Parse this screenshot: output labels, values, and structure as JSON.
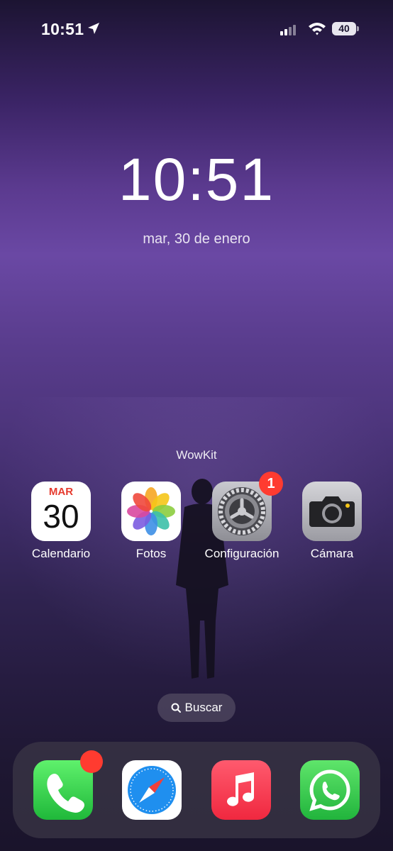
{
  "status_bar": {
    "time": "10:51",
    "battery": "40",
    "icons": [
      "location-arrow-icon",
      "signal-icon",
      "wifi-icon",
      "battery-icon"
    ]
  },
  "lock": {
    "time": "10:51",
    "date": "mar, 30 de enero"
  },
  "folder_label": "WowKit",
  "apps": [
    {
      "label": "Calendario",
      "icon": "calendar-icon",
      "day": "MAR",
      "number": "30"
    },
    {
      "label": "Fotos",
      "icon": "photos-icon"
    },
    {
      "label": "Configuración",
      "icon": "settings-gear-icon",
      "badge": "1"
    },
    {
      "label": "Cámara",
      "icon": "camera-icon"
    }
  ],
  "search": {
    "label": "Buscar"
  },
  "dock": [
    {
      "icon": "phone-icon",
      "has_badge": true
    },
    {
      "icon": "safari-compass-icon"
    },
    {
      "icon": "music-note-icon"
    },
    {
      "icon": "whatsapp-icon"
    }
  ],
  "colors": {
    "badge": "#ff3b30",
    "accent_purple": "#6a48a4"
  }
}
